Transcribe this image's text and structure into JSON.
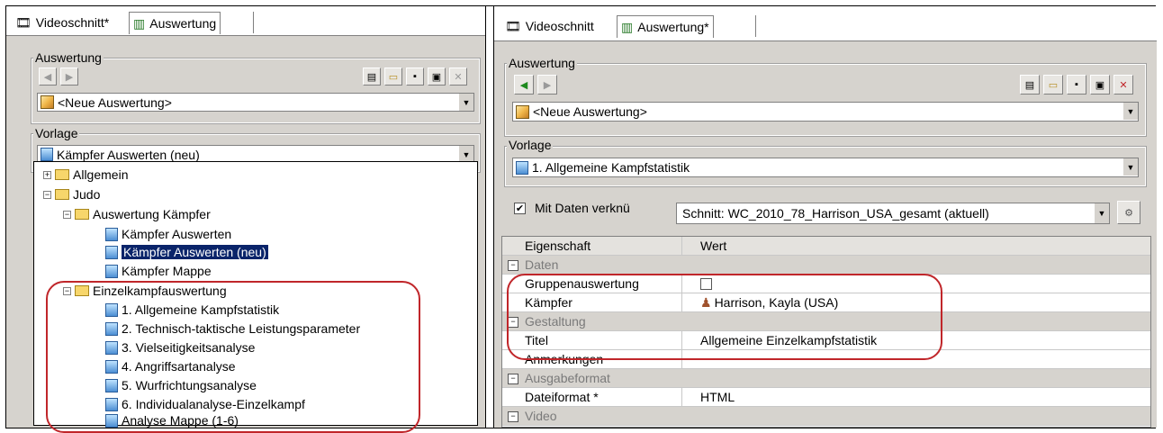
{
  "left": {
    "tabs": [
      {
        "label": "Videoschnitt*"
      },
      {
        "label": "Auswertung"
      }
    ],
    "auswertung": {
      "group_label": "Auswertung",
      "combo_value": "<Neue Auswertung>"
    },
    "vorlage": {
      "group_label": "Vorlage",
      "combo_value": "Kämpfer Auswerten (neu)"
    },
    "tree": [
      {
        "label": "Allgemein"
      },
      {
        "label": "Judo"
      },
      {
        "label": "Auswertung Kämpfer"
      },
      {
        "label": "Kämpfer Auswerten"
      },
      {
        "label": "Kämpfer Auswerten (neu)"
      },
      {
        "label": "Kämpfer Mappe"
      },
      {
        "label": "Einzelkampfauswertung"
      },
      {
        "label": "1. Allgemeine Kampfstatistik"
      },
      {
        "label": "2. Technisch-taktische Leistungsparameter"
      },
      {
        "label": "3. Vielseitigkeitsanalyse"
      },
      {
        "label": "4. Angriffsartanalyse"
      },
      {
        "label": "5. Wurfrichtungsanalyse"
      },
      {
        "label": "6. Individualanalyse-Einzelkampf"
      },
      {
        "label": "Analyse Mappe (1-6)"
      }
    ]
  },
  "right": {
    "tabs": [
      {
        "label": "Videoschnitt"
      },
      {
        "label": "Auswertung*"
      }
    ],
    "auswertung": {
      "group_label": "Auswertung",
      "combo_value": "<Neue Auswertung>"
    },
    "vorlage": {
      "group_label": "Vorlage",
      "combo_value": "1. Allgemeine Kampfstatistik"
    },
    "mit_daten": {
      "label": "Mit Daten verknü",
      "checked": true,
      "schnitt_value": "Schnitt: WC_2010_78_Harrison_USA_gesamt (aktuell)"
    },
    "grid": {
      "col1": "Eigenschaft",
      "col2": "Wert",
      "rows": [
        {
          "cat": "Daten"
        },
        {
          "name": "Gruppenauswertung",
          "value": ""
        },
        {
          "name": "Kämpfer",
          "value": "Harrison, Kayla (USA)"
        },
        {
          "cat": "Gestaltung"
        },
        {
          "name": "Titel",
          "value": "Allgemeine Einzelkampfstatistik"
        },
        {
          "name": "Anmerkungen",
          "value": ""
        },
        {
          "cat": "Ausgabeformat"
        },
        {
          "name": "Dateiformat *",
          "value": "HTML"
        },
        {
          "cat": "Video"
        }
      ]
    }
  },
  "colors": {
    "highlight": "#c0262a",
    "selection": "#0a246a",
    "panel": "#d6d3ce"
  }
}
